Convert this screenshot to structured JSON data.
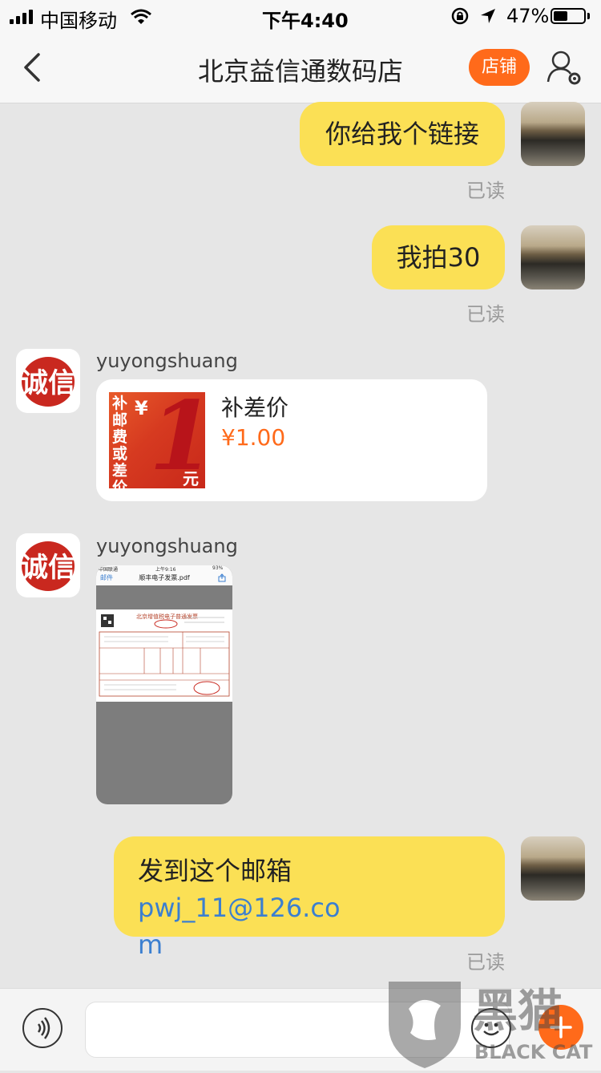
{
  "status_bar": {
    "carrier": "中国移动",
    "time": "下午4:40",
    "battery_percent": "47%",
    "battery_level": 0.47
  },
  "nav": {
    "title": "北京益信通数码店",
    "shop_button": "店铺",
    "accent_color": "#ff6a1a"
  },
  "messages": {
    "m1": {
      "text": "你给我个链接",
      "status": "已读"
    },
    "m2": {
      "text": "我拍30",
      "status": "已读"
    },
    "m3": {
      "sender": "yuyongshuang",
      "avatar_text": "诚信",
      "card_title": "补差价",
      "card_price": "¥1.00",
      "card_image_side": "补邮费或差价",
      "card_image_symbol": "¥",
      "card_image_digit": "1",
      "card_image_unit": "元"
    },
    "m4": {
      "sender": "yuyongshuang",
      "avatar_text": "诚信",
      "doc_status_carrier": "中国联通",
      "doc_status_time": "上午9:16",
      "doc_status_battery": "93%",
      "doc_back": "邮件",
      "doc_filename": "顺丰电子发票.pdf",
      "doc_heading": "北京增值税电子普通发票"
    },
    "m5": {
      "text_prefix": "发到这个邮箱",
      "email_line1": "pwj_11@126.co",
      "email_line2": "m",
      "status": "已读"
    }
  },
  "watermark": {
    "cn": "黑猫",
    "en": "BLACK CAT"
  },
  "icons": [
    "signal-icon",
    "wifi-icon",
    "lock-rotation-icon",
    "location-icon",
    "battery-icon",
    "back-arrow-icon",
    "user-settings-icon",
    "voice-icon",
    "emoji-icon",
    "plus-icon"
  ]
}
